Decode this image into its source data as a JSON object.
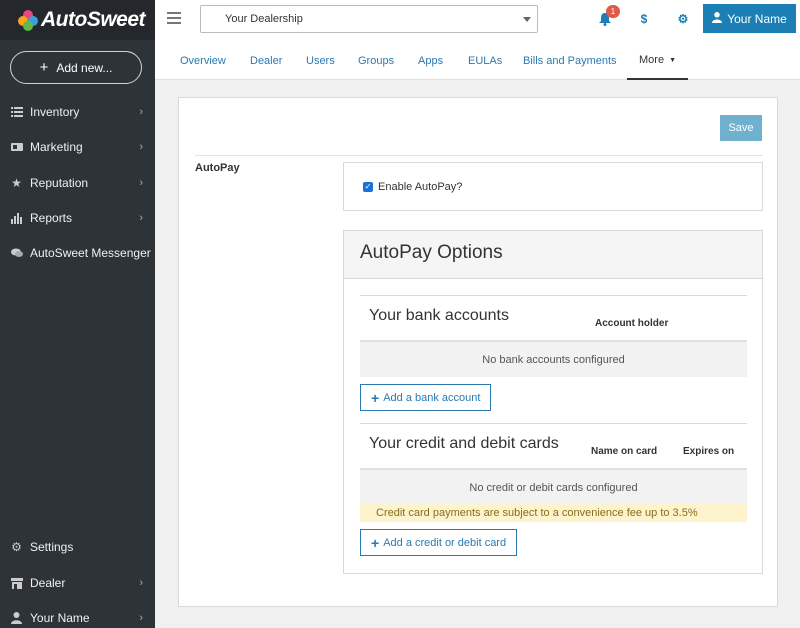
{
  "app": {
    "brand": "AutoSweet",
    "add_new_label": "Add new..."
  },
  "sidebar": {
    "items": [
      {
        "label": "Inventory",
        "icon": "list-icon",
        "has_chevron": true
      },
      {
        "label": "Marketing",
        "icon": "megaphone-icon",
        "has_chevron": true
      },
      {
        "label": "Reputation",
        "icon": "star-icon",
        "has_chevron": true
      },
      {
        "label": "Reports",
        "icon": "bar-chart-icon",
        "has_chevron": true
      },
      {
        "label": "AutoSweet Messenger",
        "icon": "chat-icon",
        "has_chevron": false
      }
    ],
    "bottom_items": [
      {
        "label": "Settings",
        "icon": "gear-icon",
        "has_chevron": false
      },
      {
        "label": "Dealer",
        "icon": "store-icon",
        "has_chevron": true
      },
      {
        "label": "Your Name",
        "icon": "user-icon",
        "has_chevron": true
      }
    ]
  },
  "topbar": {
    "dealer_select_value": "Your Dealership",
    "notification_count": "1",
    "billing_symbol": "$",
    "user_button_label": "Your Name"
  },
  "tabs": [
    {
      "label": "Overview"
    },
    {
      "label": "Dealer"
    },
    {
      "label": "Users"
    },
    {
      "label": "Groups"
    },
    {
      "label": "Apps"
    },
    {
      "label": "EULAs"
    },
    {
      "label": "Bills and Payments"
    },
    {
      "label": "More",
      "active": true
    }
  ],
  "main": {
    "save_label": "Save",
    "autopay_label": "AutoPay",
    "enable_autopay_label": "Enable AutoPay?",
    "enable_autopay_checked": true,
    "options_title": "AutoPay Options",
    "bank": {
      "title": "Your bank accounts",
      "columns": [
        "Account holder"
      ],
      "empty_text": "No bank accounts configured",
      "add_label": "Add a bank account"
    },
    "cards": {
      "title": "Your credit and debit cards",
      "columns": [
        "Name on card",
        "Expires on"
      ],
      "empty_text": "No credit or debit cards configured",
      "notice": "Credit card payments are subject to a convenience fee up to 3.5%",
      "add_label": "Add a credit or debit card"
    }
  },
  "colors": {
    "sidebar_bg": "#2e3338",
    "accent": "#1b7fb5",
    "save_button": "#6fb1cf",
    "notice_bg": "#fdf3cc",
    "badge": "#e05a4a"
  }
}
